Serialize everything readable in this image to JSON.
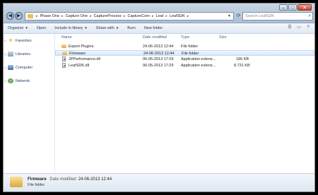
{
  "address": {
    "crumbs": [
      "Phase One",
      "Capture One",
      "CaptureProcess",
      "CaptureCore",
      "Leaf",
      "LeafSDK"
    ]
  },
  "search": {
    "placeholder": "Search LeafSDK"
  },
  "toolbar": {
    "organize": "Organize",
    "open": "Open",
    "include": "Include in library",
    "share": "Share with",
    "burn": "Burn",
    "new_folder": "New folder"
  },
  "nav": {
    "favorites": "Favorites",
    "libraries": "Libraries",
    "computer": "Computer",
    "network": "Network"
  },
  "columns": {
    "name": "Name",
    "date": "Date modified",
    "type": "Type",
    "size": "Size"
  },
  "files": [
    {
      "name": "Export Plugins",
      "date": "24-06-2013 12:44",
      "type": "File folder",
      "size": "",
      "icon": "folder-icon"
    },
    {
      "name": "Firmware",
      "date": "24-06-2013 12:44",
      "type": "File folder",
      "size": "",
      "icon": "folder-icon"
    },
    {
      "name": "JPPerformance.dll",
      "date": "06-05-2013 17:29",
      "type": "Application extens...",
      "size": "186 KB",
      "icon": "dll-file-icon"
    },
    {
      "name": "LeafSDK.dll",
      "date": "06-05-2013 17:29",
      "type": "Application extens...",
      "size": "8.731 KB",
      "icon": "dll-file-icon"
    }
  ],
  "status": {
    "name": "Firmware",
    "date_label": "Date modified:",
    "date": "24-06-2013 12:44",
    "type": "File folder"
  }
}
